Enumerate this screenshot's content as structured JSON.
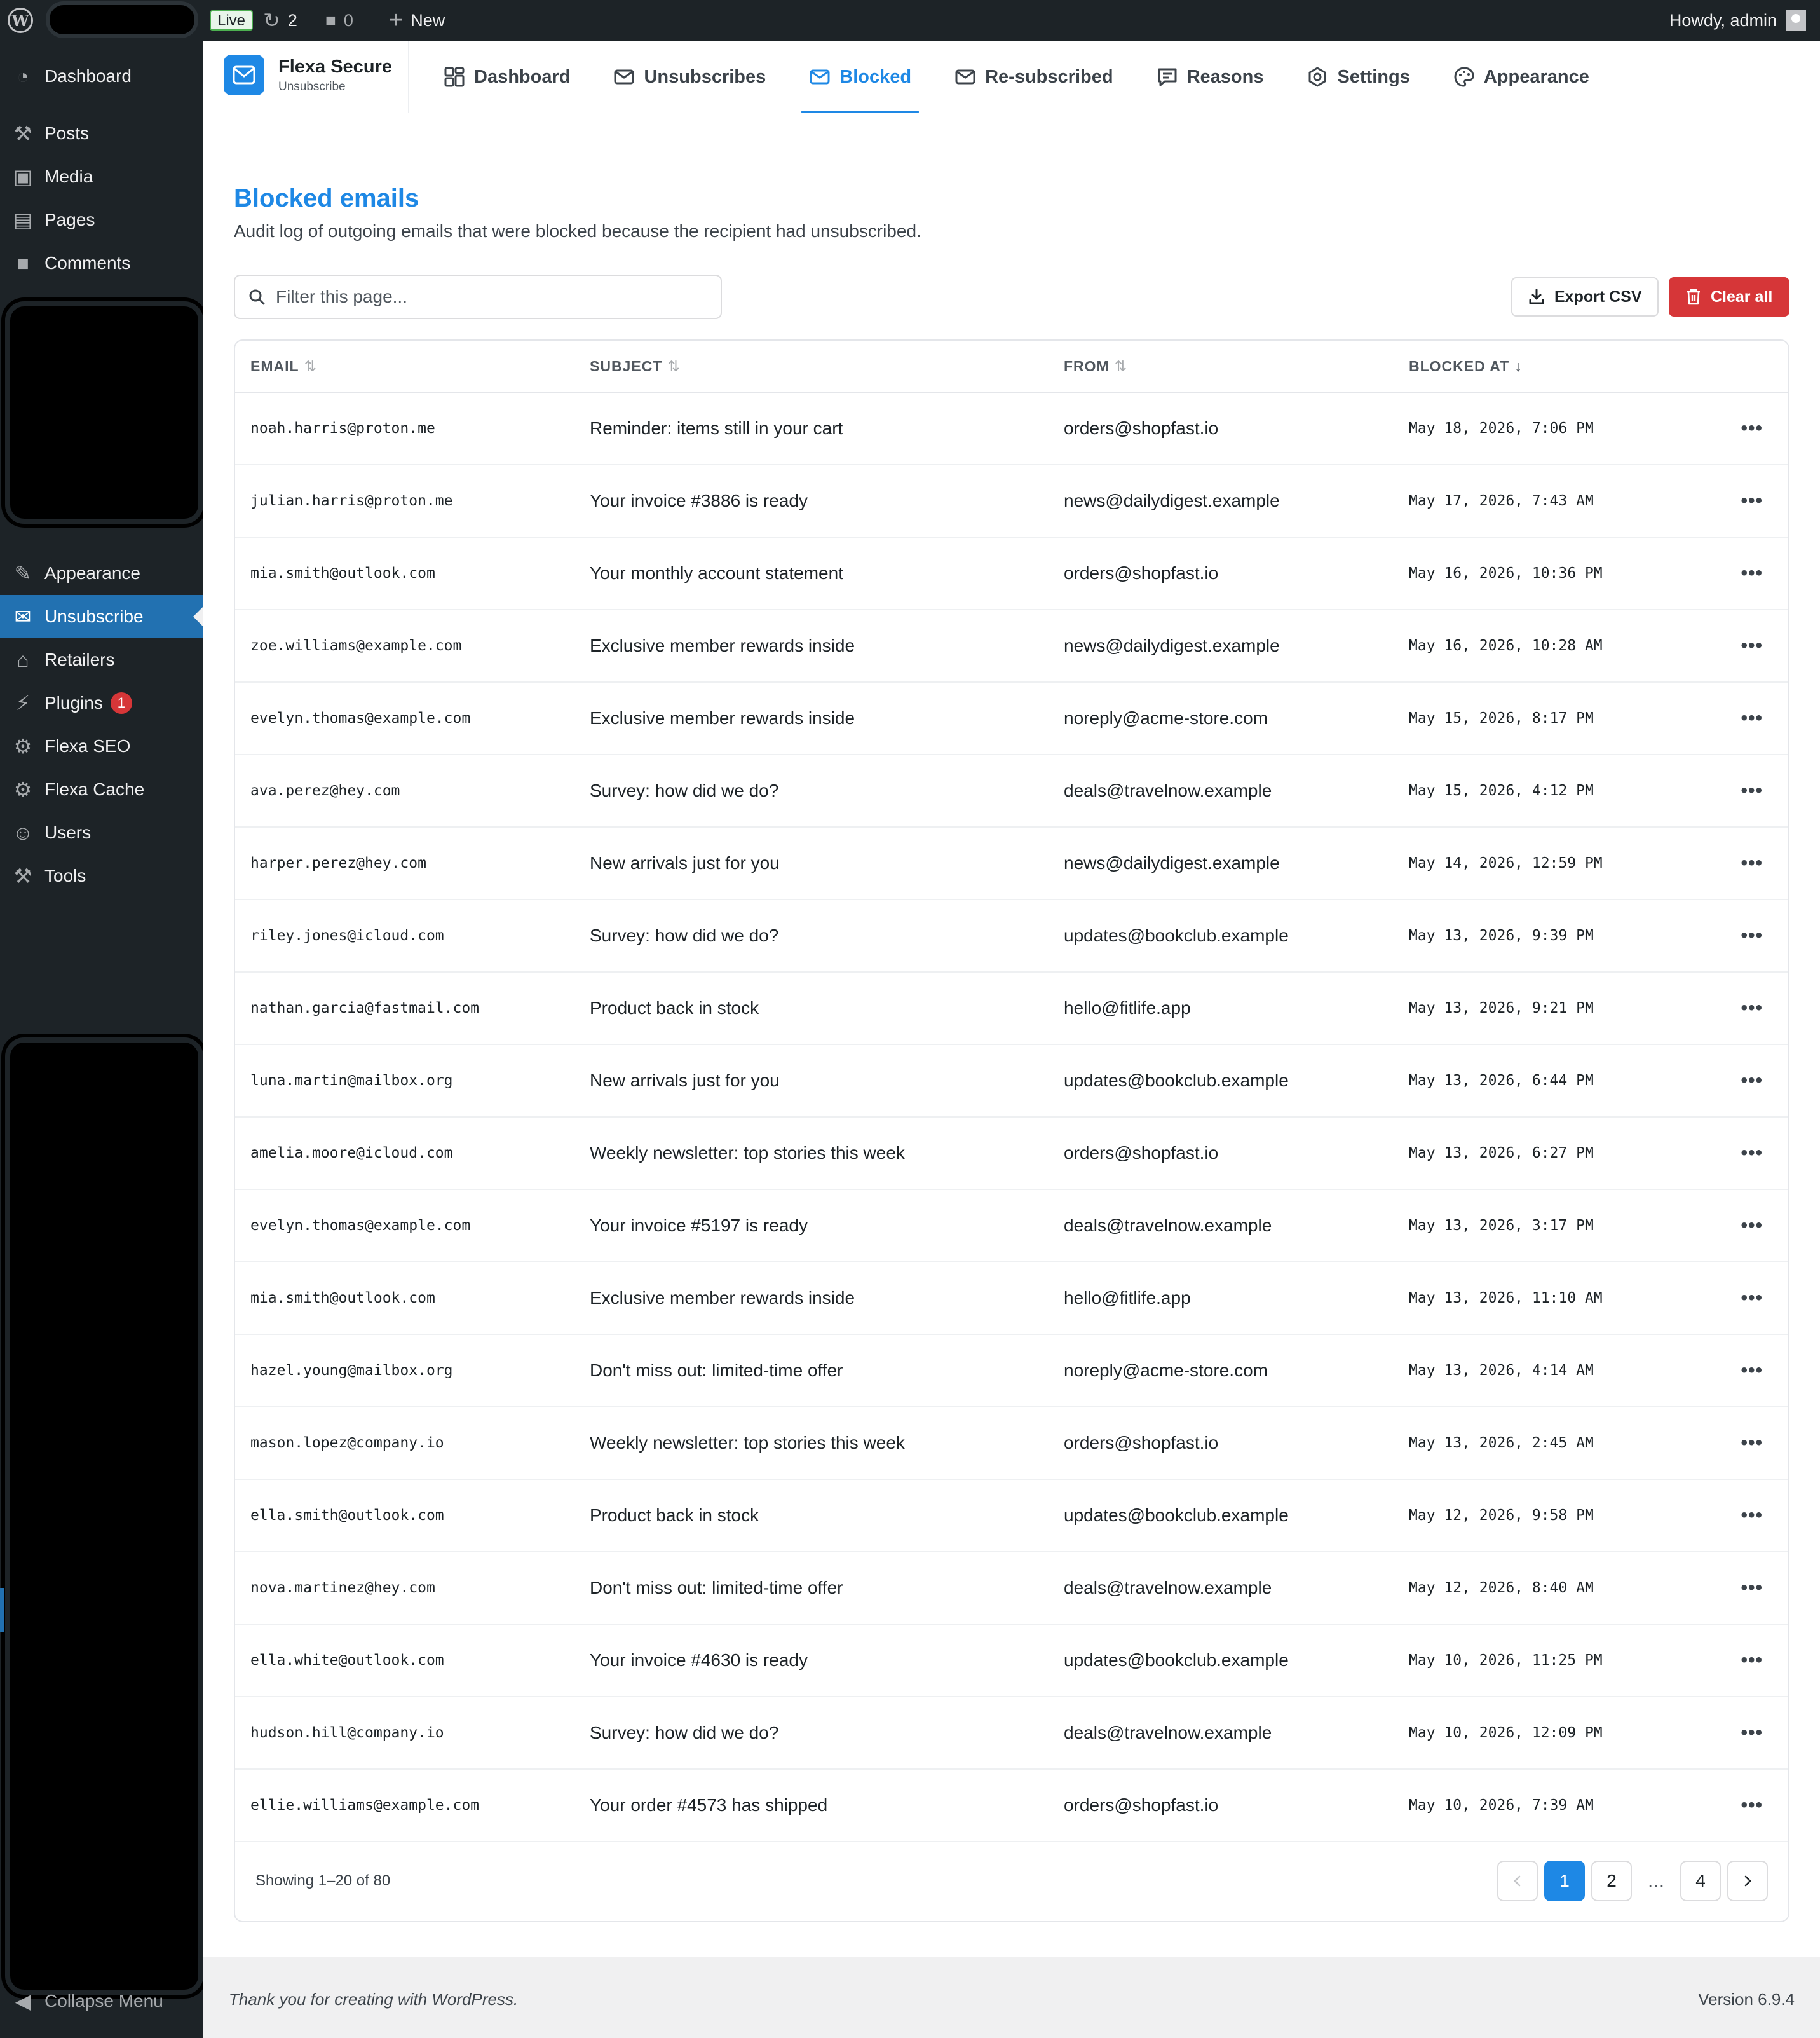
{
  "adminbar": {
    "live_label": "Live",
    "updates_count": "2",
    "comments_count": "0",
    "new_label": "New",
    "howdy": "Howdy, admin"
  },
  "sidebar": {
    "items": [
      {
        "label": "Dashboard",
        "icon": "dashboard-icon"
      },
      {
        "label": "Posts",
        "icon": "pin-icon"
      },
      {
        "label": "Media",
        "icon": "media-icon"
      },
      {
        "label": "Pages",
        "icon": "pages-icon"
      },
      {
        "label": "Comments",
        "icon": "comments-icon"
      },
      {
        "label": "Appearance",
        "icon": "brush-icon"
      },
      {
        "label": "Unsubscribe",
        "icon": "envelope-icon"
      },
      {
        "label": "Retailers",
        "icon": "store-icon"
      },
      {
        "label": "Plugins",
        "icon": "plugin-icon",
        "badge": "1"
      },
      {
        "label": "Flexa SEO",
        "icon": "gear-icon"
      },
      {
        "label": "Flexa Cache",
        "icon": "gear-icon"
      },
      {
        "label": "Users",
        "icon": "user-icon"
      },
      {
        "label": "Tools",
        "icon": "wrench-icon"
      }
    ],
    "collapse_label": "Collapse Menu"
  },
  "plugin": {
    "name": "Flexa Secure",
    "subtitle": "Unsubscribe",
    "tabs": [
      {
        "label": "Dashboard",
        "icon": "grid-icon"
      },
      {
        "label": "Unsubscribes",
        "icon": "mail-out-icon"
      },
      {
        "label": "Blocked",
        "icon": "mail-icon",
        "active": true
      },
      {
        "label": "Re-subscribed",
        "icon": "mail-check-icon"
      },
      {
        "label": "Reasons",
        "icon": "chat-icon"
      },
      {
        "label": "Settings",
        "icon": "settings-icon"
      },
      {
        "label": "Appearance",
        "icon": "palette-icon"
      }
    ]
  },
  "page": {
    "title": "Blocked emails",
    "description": "Audit log of outgoing emails that were blocked because the recipient had unsubscribed.",
    "filter_placeholder": "Filter this page...",
    "export_label": "Export CSV",
    "clear_label": "Clear all"
  },
  "table": {
    "columns": [
      "EMAIL",
      "SUBJECT",
      "FROM",
      "BLOCKED AT"
    ],
    "rows": [
      {
        "email": "noah.harris@proton.me",
        "subject": "Reminder: items still in your cart",
        "from": "orders@shopfast.io",
        "blocked_at": "May 18, 2026, 7:06 PM"
      },
      {
        "email": "julian.harris@proton.me",
        "subject": "Your invoice #3886 is ready",
        "from": "news@dailydigest.example",
        "blocked_at": "May 17, 2026, 7:43 AM"
      },
      {
        "email": "mia.smith@outlook.com",
        "subject": "Your monthly account statement",
        "from": "orders@shopfast.io",
        "blocked_at": "May 16, 2026, 10:36 PM"
      },
      {
        "email": "zoe.williams@example.com",
        "subject": "Exclusive member rewards inside",
        "from": "news@dailydigest.example",
        "blocked_at": "May 16, 2026, 10:28 AM"
      },
      {
        "email": "evelyn.thomas@example.com",
        "subject": "Exclusive member rewards inside",
        "from": "noreply@acme-store.com",
        "blocked_at": "May 15, 2026, 8:17 PM"
      },
      {
        "email": "ava.perez@hey.com",
        "subject": "Survey: how did we do?",
        "from": "deals@travelnow.example",
        "blocked_at": "May 15, 2026, 4:12 PM"
      },
      {
        "email": "harper.perez@hey.com",
        "subject": "New arrivals just for you",
        "from": "news@dailydigest.example",
        "blocked_at": "May 14, 2026, 12:59 PM"
      },
      {
        "email": "riley.jones@icloud.com",
        "subject": "Survey: how did we do?",
        "from": "updates@bookclub.example",
        "blocked_at": "May 13, 2026, 9:39 PM"
      },
      {
        "email": "nathan.garcia@fastmail.com",
        "subject": "Product back in stock",
        "from": "hello@fitlife.app",
        "blocked_at": "May 13, 2026, 9:21 PM"
      },
      {
        "email": "luna.martin@mailbox.org",
        "subject": "New arrivals just for you",
        "from": "updates@bookclub.example",
        "blocked_at": "May 13, 2026, 6:44 PM"
      },
      {
        "email": "amelia.moore@icloud.com",
        "subject": "Weekly newsletter: top stories this week",
        "from": "orders@shopfast.io",
        "blocked_at": "May 13, 2026, 6:27 PM"
      },
      {
        "email": "evelyn.thomas@example.com",
        "subject": "Your invoice #5197 is ready",
        "from": "deals@travelnow.example",
        "blocked_at": "May 13, 2026, 3:17 PM"
      },
      {
        "email": "mia.smith@outlook.com",
        "subject": "Exclusive member rewards inside",
        "from": "hello@fitlife.app",
        "blocked_at": "May 13, 2026, 11:10 AM"
      },
      {
        "email": "hazel.young@mailbox.org",
        "subject": "Don't miss out: limited-time offer",
        "from": "noreply@acme-store.com",
        "blocked_at": "May 13, 2026, 4:14 AM"
      },
      {
        "email": "mason.lopez@company.io",
        "subject": "Weekly newsletter: top stories this week",
        "from": "orders@shopfast.io",
        "blocked_at": "May 13, 2026, 2:45 AM"
      },
      {
        "email": "ella.smith@outlook.com",
        "subject": "Product back in stock",
        "from": "updates@bookclub.example",
        "blocked_at": "May 12, 2026, 9:58 PM"
      },
      {
        "email": "nova.martinez@hey.com",
        "subject": "Don't miss out: limited-time offer",
        "from": "deals@travelnow.example",
        "blocked_at": "May 12, 2026, 8:40 AM"
      },
      {
        "email": "ella.white@outlook.com",
        "subject": "Your invoice #4630 is ready",
        "from": "updates@bookclub.example",
        "blocked_at": "May 10, 2026, 11:25 PM"
      },
      {
        "email": "hudson.hill@company.io",
        "subject": "Survey: how did we do?",
        "from": "deals@travelnow.example",
        "blocked_at": "May 10, 2026, 12:09 PM"
      },
      {
        "email": "ellie.williams@example.com",
        "subject": "Your order #4573 has shipped",
        "from": "orders@shopfast.io",
        "blocked_at": "May 10, 2026, 7:39 AM"
      }
    ],
    "showing": "Showing 1–20 of 80",
    "pages": [
      "1",
      "2",
      "…",
      "4"
    ],
    "current_page": "1"
  },
  "footer": {
    "thanks": "Thank you for creating with WordPress.",
    "version": "Version 6.9.4"
  },
  "colors": {
    "accent": "#1e88e5",
    "danger": "#d63638",
    "admin_bg": "#1d2327"
  }
}
